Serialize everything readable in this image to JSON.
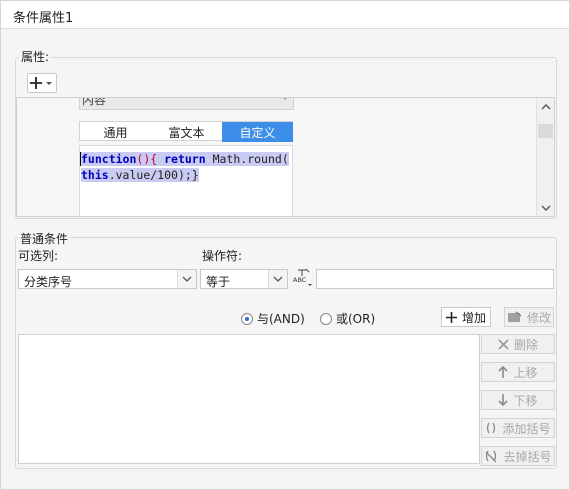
{
  "window": {
    "title": "条件属性1"
  },
  "properties": {
    "legend": "属性:",
    "add_button": "+",
    "dropdown_value": "内容",
    "tabs": [
      "通用",
      "富文本",
      "自定义"
    ],
    "active_tab": "自定义",
    "code": {
      "line1": {
        "kw": "function",
        "p1": "(){",
        "sp": " ",
        "kw2": "return",
        "rest": " Math.round("
      },
      "line2": {
        "kw": "this",
        "rest": ".value/100);}"
      }
    }
  },
  "conditions": {
    "legend": "普通条件",
    "column_label": "可选列:",
    "operator_label": "操作符:",
    "column_value": "分类序号",
    "operator_value": "等于",
    "abc_icon": "ABC",
    "value_input": "",
    "and_label": "与(AND)",
    "or_label": "或(OR)",
    "logic_selected": "and",
    "add_label": "增加",
    "modify_label": "修改",
    "delete_label": "删除",
    "move_up_label": "上移",
    "move_down_label": "下移",
    "add_bracket_label": "添加括号",
    "remove_bracket_label": "去掉括号"
  },
  "colors": {
    "accent": "#3c8ee8",
    "keyword": "#0000c0",
    "bracket": "#c0002a",
    "selection": "#c9cbf2"
  }
}
